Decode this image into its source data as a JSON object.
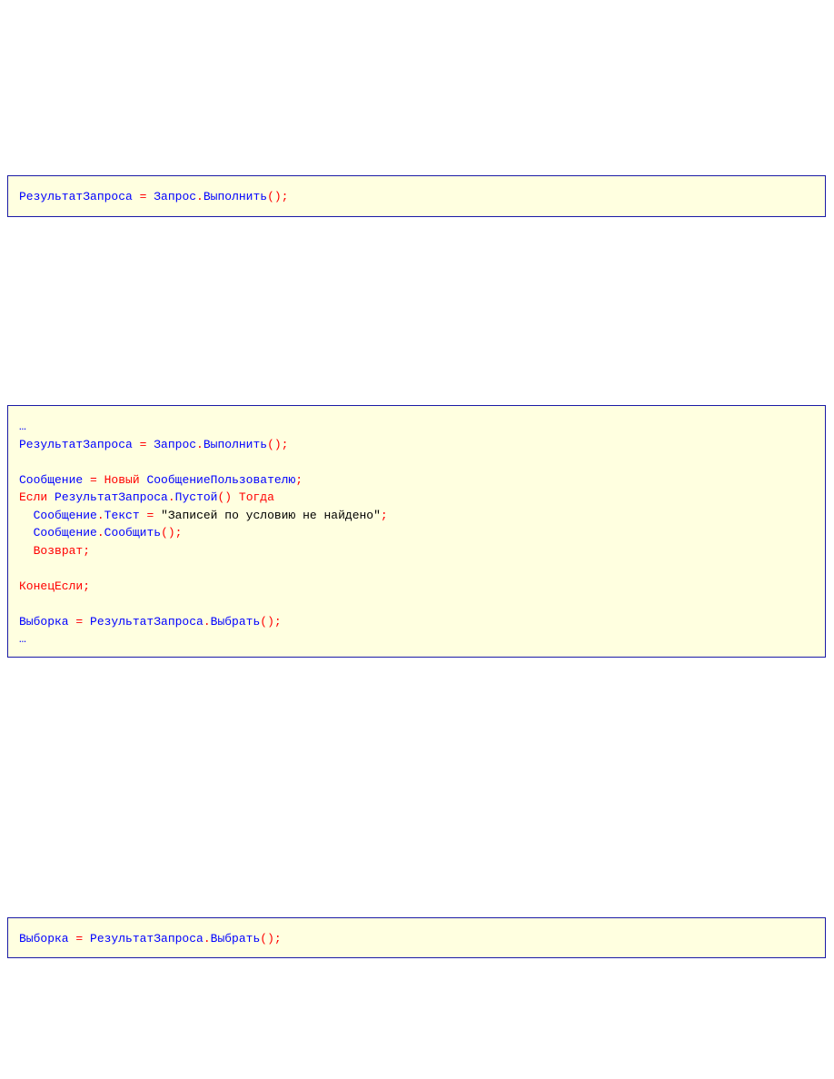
{
  "colors": {
    "identifier": "#0000ff",
    "operator_keyword": "#ff0000",
    "string": "#000000",
    "box_background": "#ffffe0",
    "box_border": "#1a1aa6"
  },
  "code_blocks": [
    {
      "lines": [
        [
          {
            "t": "РезультатЗапроса",
            "c": "ident"
          },
          {
            "t": " = ",
            "c": "op"
          },
          {
            "t": "Запрос",
            "c": "ident"
          },
          {
            "t": ".",
            "c": "op"
          },
          {
            "t": "Выполнить",
            "c": "ident"
          },
          {
            "t": "();",
            "c": "op"
          }
        ]
      ]
    },
    {
      "lines": [
        [
          {
            "t": "…",
            "c": "ident"
          }
        ],
        [
          {
            "t": "РезультатЗапроса",
            "c": "ident"
          },
          {
            "t": " = ",
            "c": "op"
          },
          {
            "t": "Запрос",
            "c": "ident"
          },
          {
            "t": ".",
            "c": "op"
          },
          {
            "t": "Выполнить",
            "c": "ident"
          },
          {
            "t": "();",
            "c": "op"
          }
        ],
        [],
        [
          {
            "t": "Сообщение",
            "c": "ident"
          },
          {
            "t": " = ",
            "c": "op"
          },
          {
            "t": "Новый",
            "c": "kw"
          },
          {
            "t": " ",
            "c": "plain"
          },
          {
            "t": "СообщениеПользователю",
            "c": "ident"
          },
          {
            "t": ";",
            "c": "op"
          }
        ],
        [
          {
            "t": "Если",
            "c": "kw"
          },
          {
            "t": " ",
            "c": "plain"
          },
          {
            "t": "РезультатЗапроса",
            "c": "ident"
          },
          {
            "t": ".",
            "c": "op"
          },
          {
            "t": "Пустой",
            "c": "ident"
          },
          {
            "t": "()",
            "c": "op"
          },
          {
            "t": " ",
            "c": "plain"
          },
          {
            "t": "Тогда",
            "c": "kw"
          }
        ],
        [
          {
            "t": "  ",
            "c": "plain"
          },
          {
            "t": "Сообщение",
            "c": "ident"
          },
          {
            "t": ".",
            "c": "op"
          },
          {
            "t": "Текст",
            "c": "ident"
          },
          {
            "t": " = ",
            "c": "op"
          },
          {
            "t": "\"Записей по условию не найдено\"",
            "c": "str"
          },
          {
            "t": ";",
            "c": "op"
          }
        ],
        [
          {
            "t": "  ",
            "c": "plain"
          },
          {
            "t": "Сообщение",
            "c": "ident"
          },
          {
            "t": ".",
            "c": "op"
          },
          {
            "t": "Сообщить",
            "c": "ident"
          },
          {
            "t": "();",
            "c": "op"
          }
        ],
        [
          {
            "t": "  ",
            "c": "plain"
          },
          {
            "t": "Возврат;",
            "c": "kw"
          }
        ],
        [],
        [
          {
            "t": "КонецЕсли;",
            "c": "kw"
          }
        ],
        [],
        [
          {
            "t": "Выборка",
            "c": "ident"
          },
          {
            "t": " = ",
            "c": "op"
          },
          {
            "t": "РезультатЗапроса",
            "c": "ident"
          },
          {
            "t": ".",
            "c": "op"
          },
          {
            "t": "Выбрать",
            "c": "ident"
          },
          {
            "t": "();",
            "c": "op"
          }
        ],
        [
          {
            "t": "…",
            "c": "ident"
          }
        ]
      ]
    },
    {
      "lines": [
        [
          {
            "t": "Выборка",
            "c": "ident"
          },
          {
            "t": " = ",
            "c": "op"
          },
          {
            "t": "РезультатЗапроса",
            "c": "ident"
          },
          {
            "t": ".",
            "c": "op"
          },
          {
            "t": "Выбрать",
            "c": "ident"
          },
          {
            "t": "();",
            "c": "op"
          }
        ]
      ]
    }
  ]
}
